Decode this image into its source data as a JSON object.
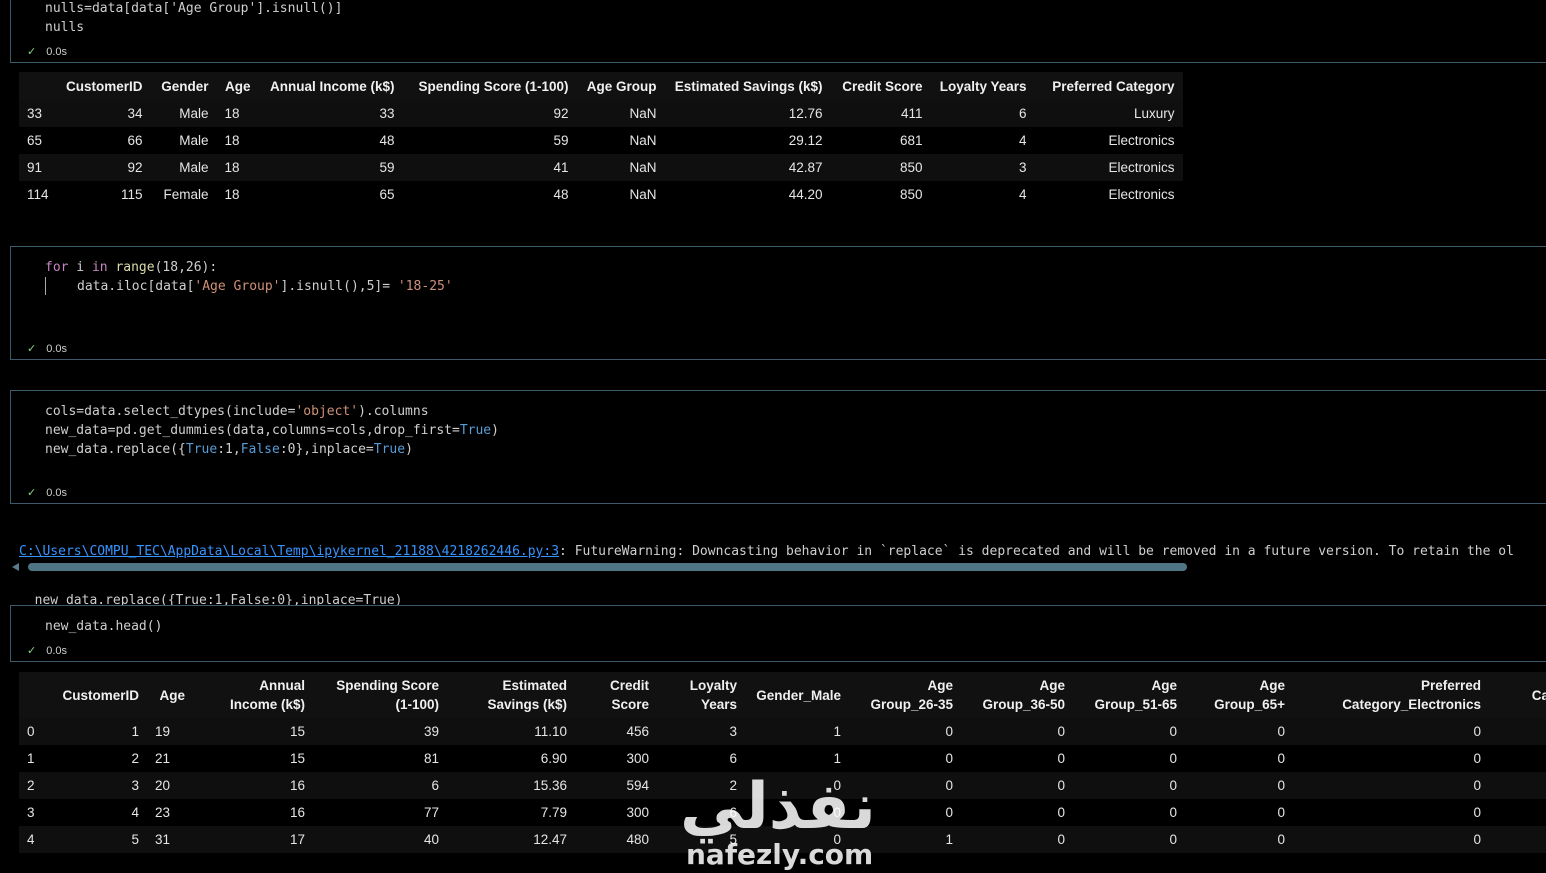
{
  "cell1": {
    "lines": [
      "nulls=data[data['Age Group'].isnull()]",
      "nulls"
    ],
    "time": "0.0s"
  },
  "table1": {
    "headers": [
      "",
      "CustomerID",
      "Gender",
      "Age",
      "Annual Income (k$)",
      "Spending Score (1-100)",
      "Age Group",
      "Estimated Savings (k$)",
      "Credit Score",
      "Loyalty Years",
      "Preferred Category"
    ],
    "rows": [
      [
        "33",
        "34",
        "Male",
        "18",
        "33",
        "92",
        "NaN",
        "12.76",
        "411",
        "6",
        "Luxury"
      ],
      [
        "65",
        "66",
        "Male",
        "18",
        "48",
        "59",
        "NaN",
        "29.12",
        "681",
        "4",
        "Electronics"
      ],
      [
        "91",
        "92",
        "Male",
        "18",
        "59",
        "41",
        "NaN",
        "42.87",
        "850",
        "3",
        "Electronics"
      ],
      [
        "114",
        "115",
        "Female",
        "18",
        "65",
        "48",
        "NaN",
        "44.20",
        "850",
        "4",
        "Electronics"
      ]
    ]
  },
  "cell2": {
    "line1": {
      "kw": "for",
      "var": " i ",
      "kw2": "in",
      "fn": " range",
      "rest": "(18,26):"
    },
    "line2": {
      "pre": "data.iloc[data[",
      "str1": "'Age Group'",
      "mid": "].isnull(),5]= ",
      "str2": "'18-25'"
    },
    "time": "0.0s"
  },
  "cell3": {
    "line1": {
      "pre": "cols=data.select_dtypes(include=",
      "str": "'object'",
      "post": ").columns"
    },
    "line2": {
      "pre": "new_data=pd.get_dummies(data,columns=cols,drop_first=",
      "bool": "True",
      "post": ")"
    },
    "line3": {
      "pre": "new_data.replace({",
      "b1": "True",
      "m1": ":1,",
      "b2": "False",
      "m2": ":0},inplace=",
      "b3": "True",
      "post": ")"
    },
    "time": "0.0s"
  },
  "warning": {
    "path": "C:\\Users\\COMPU_TEC\\AppData\\Local\\Temp\\ipykernel_21188\\4218262446.py:3",
    "message": ": FutureWarning: Downcasting behavior in `replace` is deprecated and will be removed in a future version. To retain the ol",
    "code": "  new_data.replace({True:1,False:0},inplace=True)"
  },
  "cell4": {
    "line": "new_data.head()",
    "time": "0.0s"
  },
  "table2": {
    "headers": [
      [
        ""
      ],
      [
        "CustomerID"
      ],
      [
        "Age"
      ],
      [
        "Annual",
        "Income (k$)"
      ],
      [
        "Spending Score",
        "(1-100)"
      ],
      [
        "Estimated",
        "Savings (k$)"
      ],
      [
        "Credit",
        "Score"
      ],
      [
        "Loyalty",
        "Years"
      ],
      [
        "Gender_Male"
      ],
      [
        "Age",
        "Group_26-35"
      ],
      [
        "Age",
        "Group_36-50"
      ],
      [
        "Age",
        "Group_51-65"
      ],
      [
        "Age",
        "Group_65+"
      ],
      [
        "Preferred",
        "Category_Electronics"
      ],
      [
        "",
        "Cate"
      ]
    ],
    "rows": [
      [
        "0",
        "1",
        "19",
        "15",
        "39",
        "11.10",
        "456",
        "3",
        "1",
        "0",
        "0",
        "0",
        "0",
        "0",
        ""
      ],
      [
        "1",
        "2",
        "21",
        "15",
        "81",
        "6.90",
        "300",
        "6",
        "1",
        "0",
        "0",
        "0",
        "0",
        "0",
        ""
      ],
      [
        "2",
        "3",
        "20",
        "16",
        "6",
        "15.36",
        "594",
        "2",
        "0",
        "0",
        "0",
        "0",
        "0",
        "0",
        ""
      ],
      [
        "3",
        "4",
        "23",
        "16",
        "77",
        "7.79",
        "300",
        "6",
        "0",
        "0",
        "0",
        "0",
        "0",
        "0",
        ""
      ],
      [
        "4",
        "5",
        "31",
        "17",
        "40",
        "12.47",
        "480",
        "5",
        "0",
        "1",
        "0",
        "0",
        "0",
        "0",
        ""
      ]
    ]
  },
  "watermark": {
    "arabic": "نفذلي",
    "latin": "nafezly.com"
  },
  "icons": {
    "check": "check-icon",
    "scroll_left": "scroll-left-icon"
  }
}
